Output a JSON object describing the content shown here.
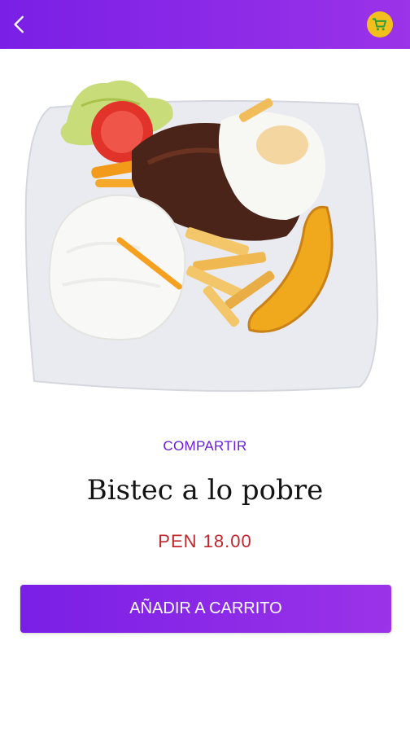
{
  "header": {
    "back_icon": "chevron-left-icon",
    "cart_icon": "shopping-cart-icon",
    "colors": {
      "gradient_start": "#7a1fe6",
      "gradient_end": "#9b33e8",
      "cart_badge": "#f2bf1c"
    }
  },
  "product": {
    "image_icon": "food-plate-image",
    "share_label": "COMPARTIR",
    "name": "Bistec a lo pobre",
    "price": "PEN 18.00"
  },
  "actions": {
    "add_to_cart_label": "AÑADIR A CARRITO"
  }
}
